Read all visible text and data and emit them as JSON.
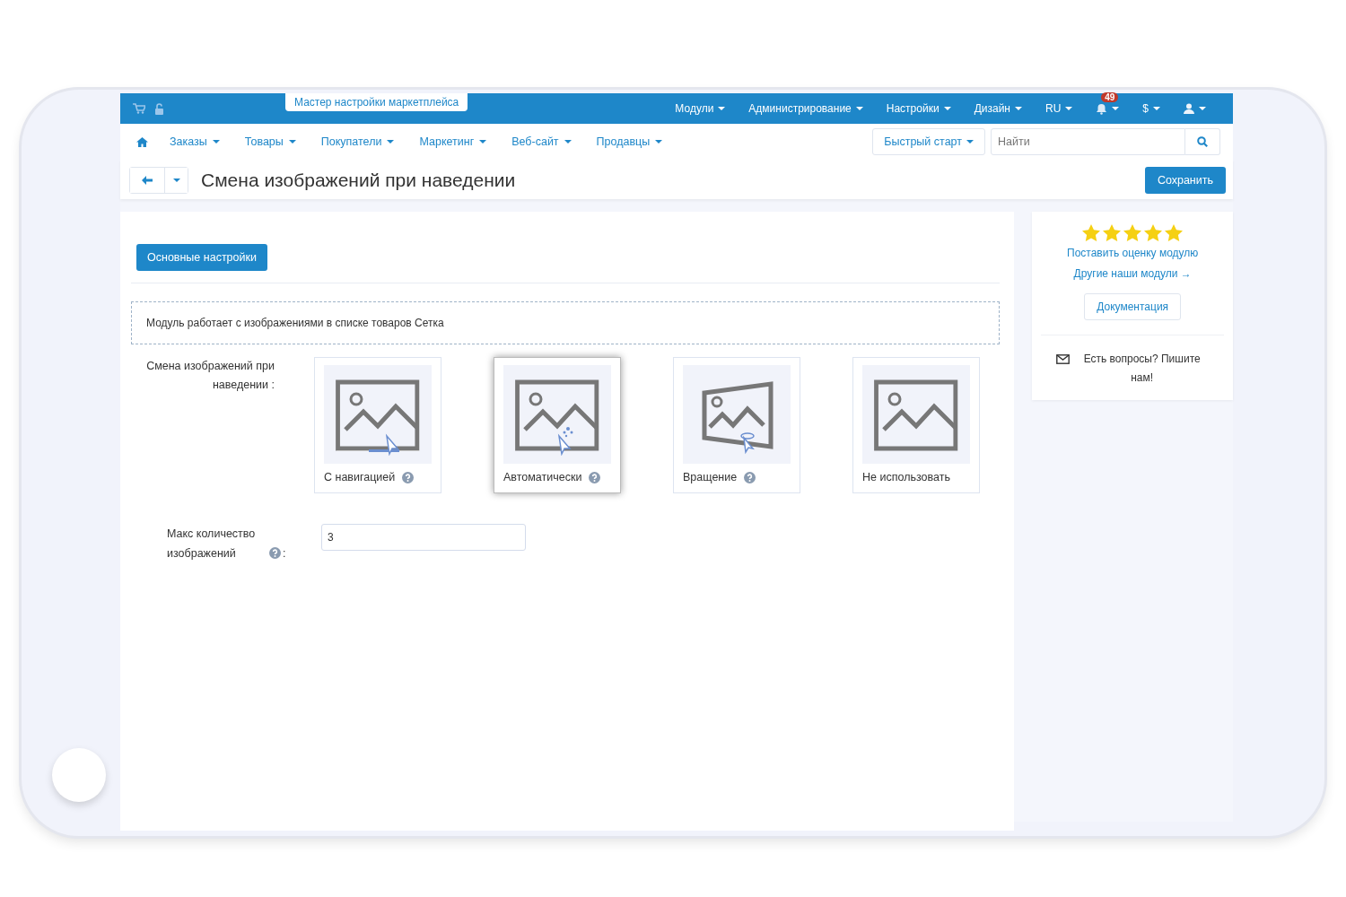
{
  "top_bar": {
    "wizard_tab": "Мастер настройки маркетплейса",
    "menus": [
      {
        "kind": "text",
        "label": "Модули"
      },
      {
        "kind": "text",
        "label": "Администрирование"
      },
      {
        "kind": "text",
        "label": "Настройки"
      },
      {
        "kind": "text",
        "label": "Дизайн"
      },
      {
        "kind": "text",
        "label": "RU"
      },
      {
        "kind": "bell",
        "badge": "49"
      },
      {
        "kind": "text",
        "label": "$"
      },
      {
        "kind": "user"
      }
    ]
  },
  "nav": {
    "items": [
      "Заказы",
      "Товары",
      "Покупатели",
      "Маркетинг",
      "Веб-сайт",
      "Продавцы"
    ],
    "quick_start": "Быстрый старт",
    "search": {
      "placeholder": "Найти"
    }
  },
  "page": {
    "title": "Смена изображений при наведении",
    "save": "Сохранить"
  },
  "tabs": [
    {
      "label": "Основные настройки",
      "selected": true
    }
  ],
  "notice": "Модуль работает с изображениями в списке товаров Сетка",
  "hover_setting": {
    "label": "Смена изображений при наведении :",
    "options": [
      {
        "kind": "navigation",
        "label": "С навигацией",
        "help": true,
        "selected": false
      },
      {
        "kind": "auto",
        "label": "Автоматически",
        "help": true,
        "selected": true
      },
      {
        "kind": "rotate",
        "label": "Вращение",
        "help": true,
        "selected": false
      },
      {
        "kind": "none",
        "label": "Не использовать",
        "help": false,
        "selected": false
      }
    ]
  },
  "max_images": {
    "label": "Макс количество изображений",
    "suffix": ":",
    "value": "3"
  },
  "sidebar": {
    "stars": 5,
    "rate_link": "Поставить оценку модулю",
    "other_link": "Другие наши модули →",
    "docs": "Документация",
    "contact": "Есть вопросы? Пишите нам!"
  }
}
